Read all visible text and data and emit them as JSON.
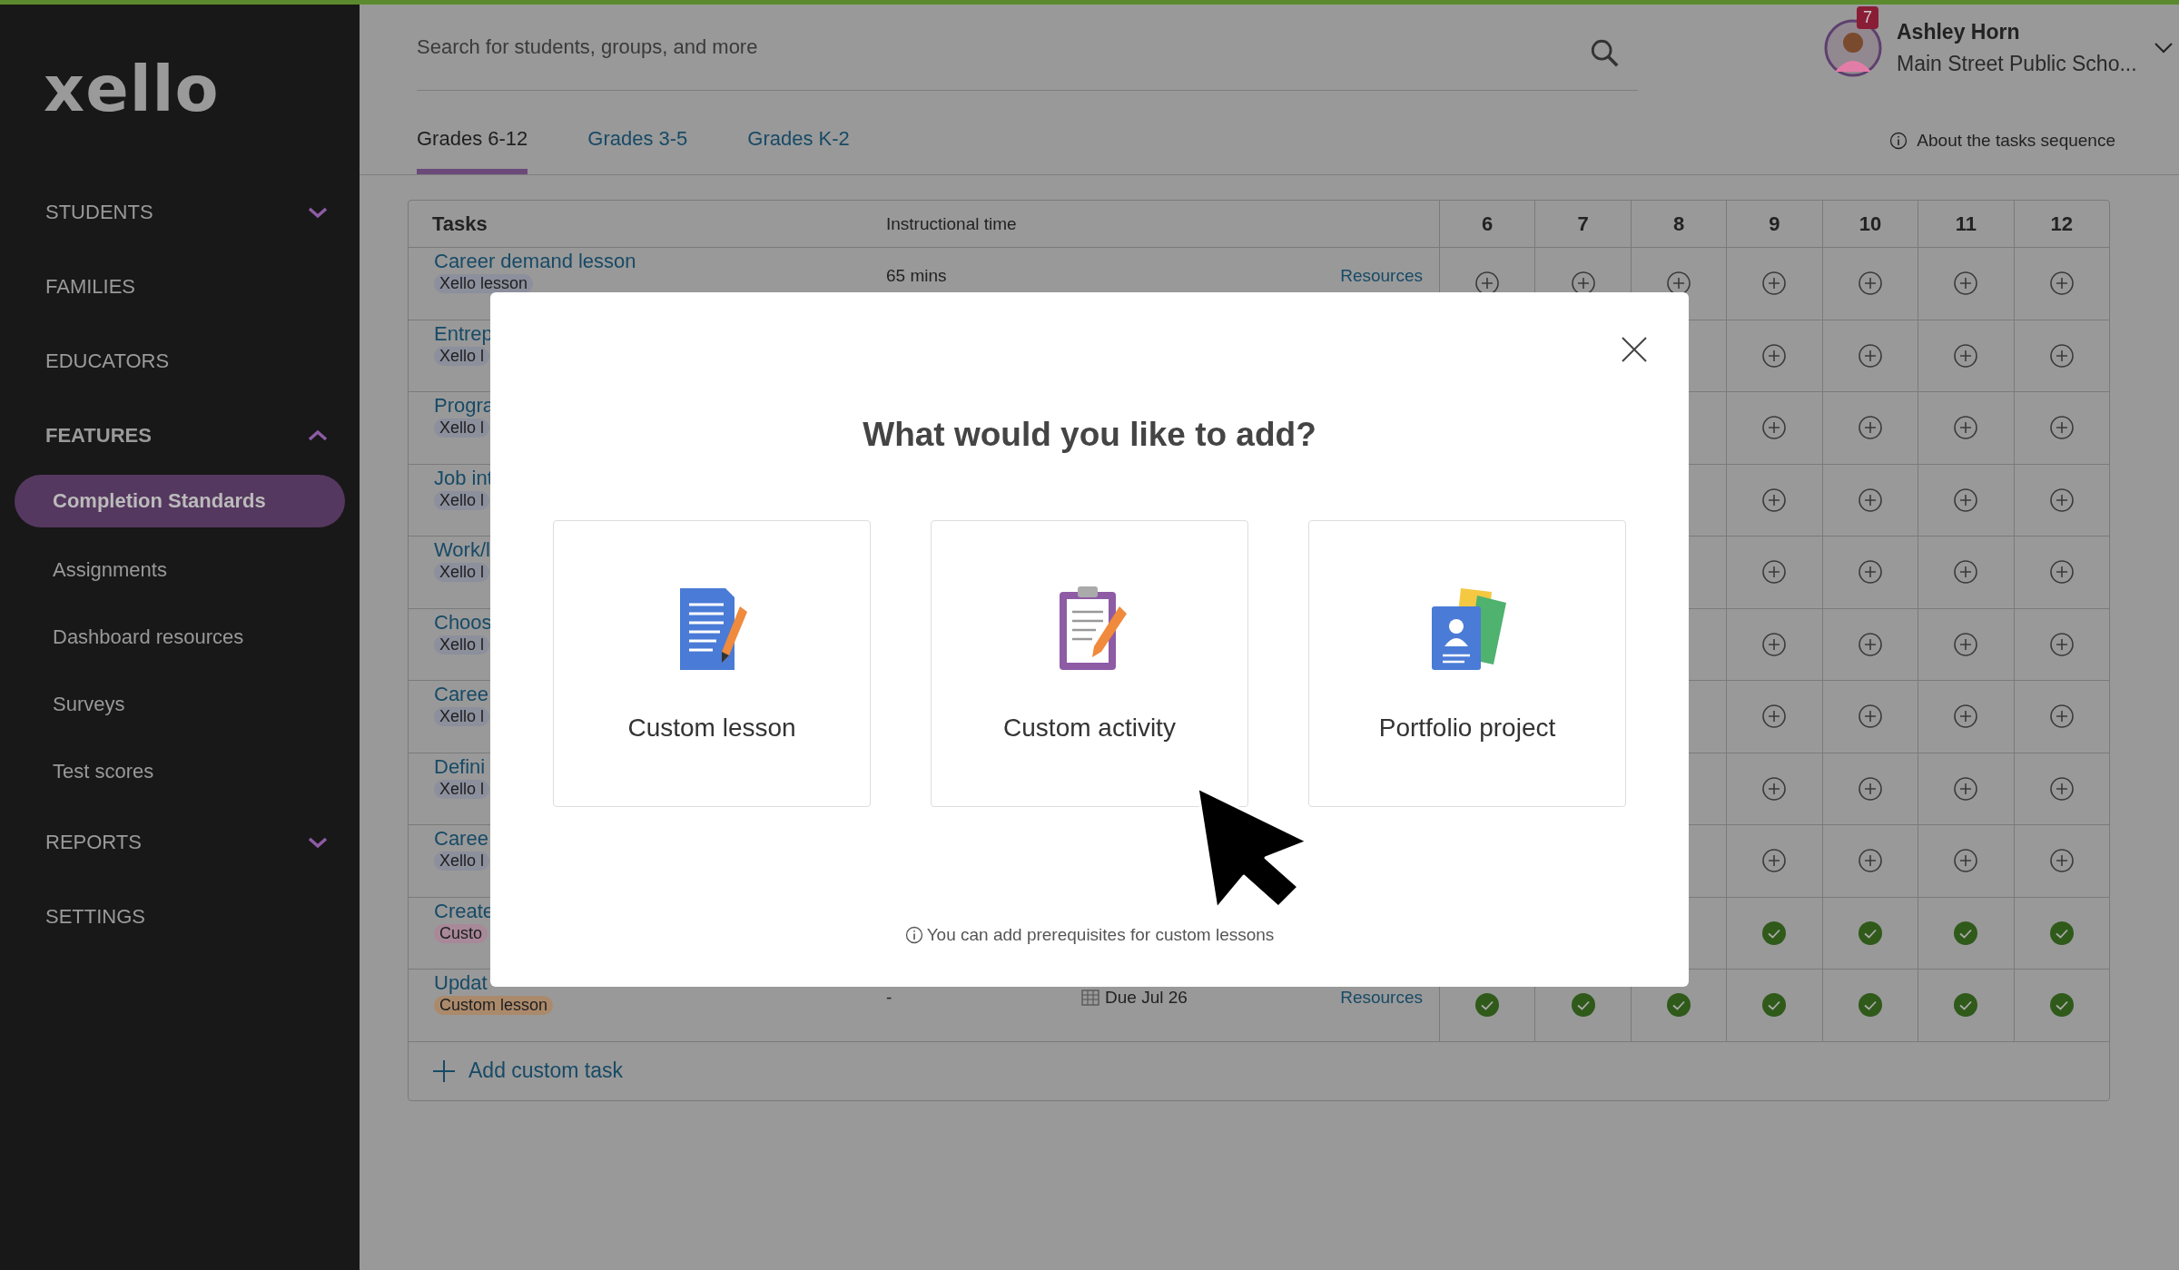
{
  "sidebar": {
    "logo": "xello",
    "items": [
      {
        "label": "STUDENTS",
        "kind": "group",
        "expanded": false
      },
      {
        "label": "FAMILIES",
        "kind": "link"
      },
      {
        "label": "EDUCATORS",
        "kind": "link"
      },
      {
        "label": "FEATURES",
        "kind": "group",
        "expanded": true,
        "children": [
          {
            "label": "Completion Standards",
            "selected": true
          },
          {
            "label": "Assignments",
            "selected": false
          },
          {
            "label": "Dashboard resources",
            "selected": false
          },
          {
            "label": "Surveys",
            "selected": false
          },
          {
            "label": "Test scores",
            "selected": false
          }
        ]
      },
      {
        "label": "REPORTS",
        "kind": "group",
        "expanded": false
      },
      {
        "label": "SETTINGS",
        "kind": "link"
      }
    ]
  },
  "header": {
    "search": {
      "placeholder": "Search for students, groups, and more"
    },
    "user": {
      "name": "Ashley Horn",
      "school": "Main Street Public Scho...",
      "badge": "7"
    }
  },
  "tabs": [
    {
      "label": "Grades 6-12",
      "selected": true
    },
    {
      "label": "Grades 3-5",
      "selected": false
    },
    {
      "label": "Grades K-2",
      "selected": false
    }
  ],
  "info_link": "About the tasks sequence",
  "table": {
    "columns": [
      "Tasks",
      "Instructional time",
      "6",
      "7",
      "8",
      "9",
      "10",
      "11",
      "12"
    ],
    "rows": [
      {
        "title": "Career demand lesson",
        "tag": {
          "text": "Xello lesson",
          "color": "#8c8f9c"
        },
        "time": "65 mins",
        "resources": "Resources",
        "cells": [
          {
            "kind": "add"
          },
          {
            "kind": "add"
          },
          {
            "kind": "add"
          },
          {
            "kind": "add"
          },
          {
            "kind": "add"
          },
          {
            "kind": "add"
          },
          {
            "kind": "add"
          }
        ]
      },
      {
        "title": "Entrep",
        "tag": {
          "text": "Xello l",
          "color": "#8c8f9c"
        },
        "cells": [
          {
            "kind": "add"
          },
          {
            "kind": "add"
          },
          {
            "kind": "add"
          },
          {
            "kind": "add"
          }
        ]
      },
      {
        "title": "Progra",
        "tag": {
          "text": "Xello l",
          "color": "#8c8f9c"
        },
        "cells": [
          {
            "kind": "add"
          },
          {
            "kind": "add"
          },
          {
            "kind": "add"
          },
          {
            "kind": "add"
          }
        ]
      },
      {
        "title": "Job int",
        "tag": {
          "text": "Xello l",
          "color": "#8c8f9c"
        },
        "cells": [
          {
            "kind": "add"
          },
          {
            "kind": "add"
          },
          {
            "kind": "add"
          },
          {
            "kind": "add"
          }
        ]
      },
      {
        "title": "Work/l",
        "tag": {
          "text": "Xello l",
          "color": "#8c8f9c"
        },
        "cells": [
          {
            "kind": "add"
          },
          {
            "kind": "add"
          },
          {
            "kind": "add"
          },
          {
            "kind": "add"
          }
        ]
      },
      {
        "title": "Choos",
        "tag": {
          "text": "Xello l",
          "color": "#8c8f9c"
        },
        "cells": [
          {
            "kind": "add"
          },
          {
            "kind": "add"
          },
          {
            "kind": "add"
          },
          {
            "kind": "add"
          }
        ]
      },
      {
        "title": "Caree",
        "tag": {
          "text": "Xello l",
          "color": "#8c8f9c"
        },
        "cells": [
          {
            "kind": "add"
          },
          {
            "kind": "add"
          },
          {
            "kind": "add"
          },
          {
            "kind": "add"
          }
        ]
      },
      {
        "title": "Defini",
        "tag": {
          "text": "Xello l",
          "color": "#8c8f9c"
        },
        "cells": [
          {
            "kind": "add"
          },
          {
            "kind": "add"
          },
          {
            "kind": "add"
          },
          {
            "kind": "add"
          }
        ]
      },
      {
        "title": "Caree",
        "tag": {
          "text": "Xello l",
          "color": "#8c8f9c"
        },
        "cells": [
          {
            "kind": "add"
          },
          {
            "kind": "add"
          },
          {
            "kind": "add"
          },
          {
            "kind": "add"
          }
        ]
      },
      {
        "title": "Create",
        "tag": {
          "text": "Custo",
          "color": "#a88899"
        },
        "cells": [
          {
            "kind": "done"
          },
          {
            "kind": "done"
          },
          {
            "kind": "done"
          },
          {
            "kind": "done"
          }
        ]
      },
      {
        "title": "Updat",
        "tag": {
          "text": "Custom lesson",
          "color": "#ab8a6c"
        },
        "time": "-",
        "due": "Due Jul 26",
        "resources": "Resources",
        "cells": [
          {
            "kind": "done"
          },
          {
            "kind": "done"
          },
          {
            "kind": "done"
          },
          {
            "kind": "done"
          },
          {
            "kind": "done"
          },
          {
            "kind": "done"
          },
          {
            "kind": "done"
          }
        ]
      }
    ],
    "add_task": "Add custom task"
  },
  "modal": {
    "title": "What would you like to add?",
    "options": [
      {
        "label": "Custom lesson",
        "kind": "lesson"
      },
      {
        "label": "Custom activity",
        "kind": "activity"
      },
      {
        "label": "Portfolio project",
        "kind": "portfolio"
      }
    ],
    "note": "You can add prerequisites for custom lessons"
  }
}
